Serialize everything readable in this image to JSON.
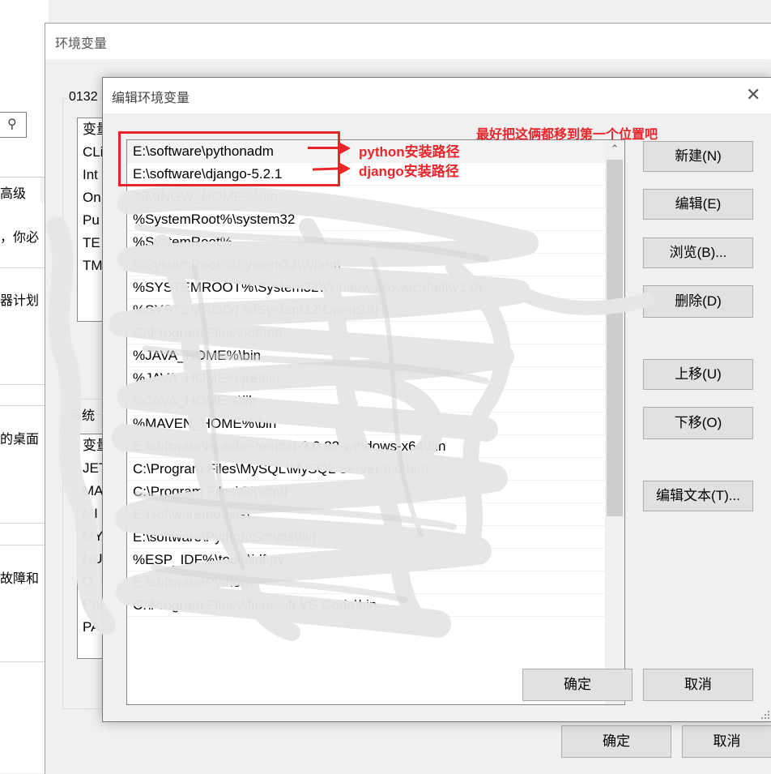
{
  "system_properties": {
    "search_icon": "search-icon",
    "tab_label": "高级",
    "fragments": [
      "，你必",
      "器计划",
      "的桌面",
      "故障和"
    ]
  },
  "env_dialog": {
    "title": "环境变量",
    "user_group_label": "0132",
    "user_vars": [
      "变量",
      "CLi",
      "Int",
      "On",
      "Pu",
      "TE",
      "TM"
    ],
    "system_group_label": "系统",
    "system_vars": [
      "变量",
      "JET",
      "MA",
      "MI",
      "MY",
      "NU",
      "O",
      "Pat",
      "PA"
    ],
    "ok_label": "确定",
    "cancel_label": "取消"
  },
  "edit_dialog": {
    "title": "编辑环境变量",
    "close_icon": "close-icon",
    "path_entries": [
      "E:\\software\\pythonadm",
      "E:\\software\\django-5.2.1",
      "%MINGW_HOME%\\bin",
      "%SystemRoot%\\system32",
      "%SystemRoot%",
      "%SystemRoot%\\System32\\Wbem",
      "%SYSTEMROOT%\\System32\\WindowsPowerShell\\v1.0\\",
      "%SYSTEMROOT%\\System32\\OpenSSH\\",
      "C:\\Program Files\\dotnet\\",
      "%JAVA_HOME%\\bin",
      "%JAVA_HOME%\\jre\\bin",
      "%JAVA_HOME%\\lib",
      "%MAVEN_HOME%\\bin",
      "E:\\software\\apache-tomcat-9.0.82-windows-x64\\bin",
      "C:\\Program Files\\MySQL\\MySQL Server 8.0\\bin\\",
      "C:\\Program Files\\Git\\cmd",
      "E:\\software\\nodejs\\",
      "E:\\software\\Python\\Scripts\\bin",
      "%ESP_IDF%\\tools\\idf.py",
      "E:\\software\\Python\\",
      "C:\\Program Files\\Microsoft VS Code\\bin"
    ],
    "buttons": {
      "new": "新建(N)",
      "edit": "编辑(E)",
      "browse": "浏览(B)...",
      "delete": "删除(D)",
      "move_up": "上移(U)",
      "move_down": "下移(O)",
      "edit_text": "编辑文本(T)...",
      "ok": "确定",
      "cancel": "取消"
    }
  },
  "annotations": {
    "color": "#e8262a",
    "note_top": "最好把这俩都移到第一个位置吧",
    "python_label": "python安装路径",
    "django_label": "django安装路径"
  }
}
